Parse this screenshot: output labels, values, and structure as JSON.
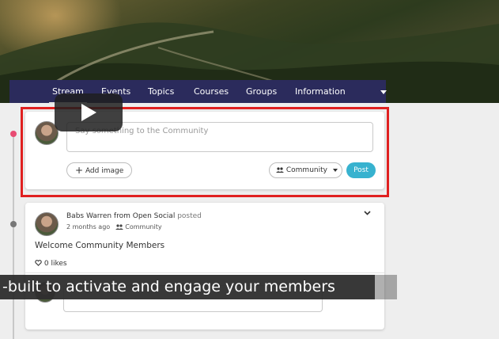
{
  "nav": {
    "items": [
      "Stream",
      "Events",
      "Topics",
      "Courses",
      "Groups",
      "Information"
    ],
    "active": "Stream"
  },
  "composer": {
    "placeholder": "Say something to the Community",
    "add_image_label": "Add image",
    "visibility_label": "Community",
    "post_label": "Post"
  },
  "post": {
    "author": "Babs Warren from Open Social",
    "verb": "posted",
    "time": "2 months ago",
    "visibility": "Community",
    "body": "Welcome Community Members",
    "likes": "0 likes"
  },
  "caption": "-built to activate and engage your members",
  "colors": {
    "nav_bg": "#2b2b5c",
    "post_button": "#37b2cf",
    "highlight": "#e02020",
    "timeline_dot_active": "#e84c73"
  },
  "icons": [
    "play-icon",
    "plus-icon",
    "people-icon",
    "chevron-down-icon",
    "heart-icon"
  ]
}
